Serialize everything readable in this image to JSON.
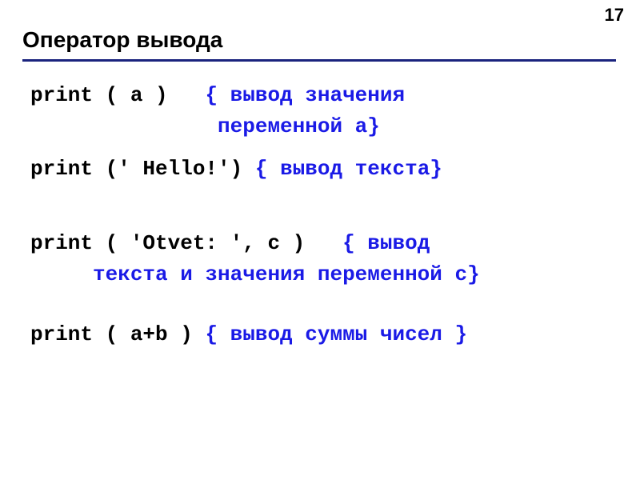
{
  "page_number": "17",
  "title": "Оператор вывода",
  "lines": {
    "l1a": "print ( a )   ",
    "l1b": "{ вывод значения",
    "l2": "               переменной a}",
    "l3a": "print (' Hello!') ",
    "l3b": "{ вывод текста}",
    "l4a": "print ( 'Otvet: ', c )   ",
    "l4b": "{ вывод",
    "l5": "     текста и значения переменной c}",
    "l6a": "print ( a+b ) ",
    "l6b": "{ вывод суммы чисел }"
  }
}
